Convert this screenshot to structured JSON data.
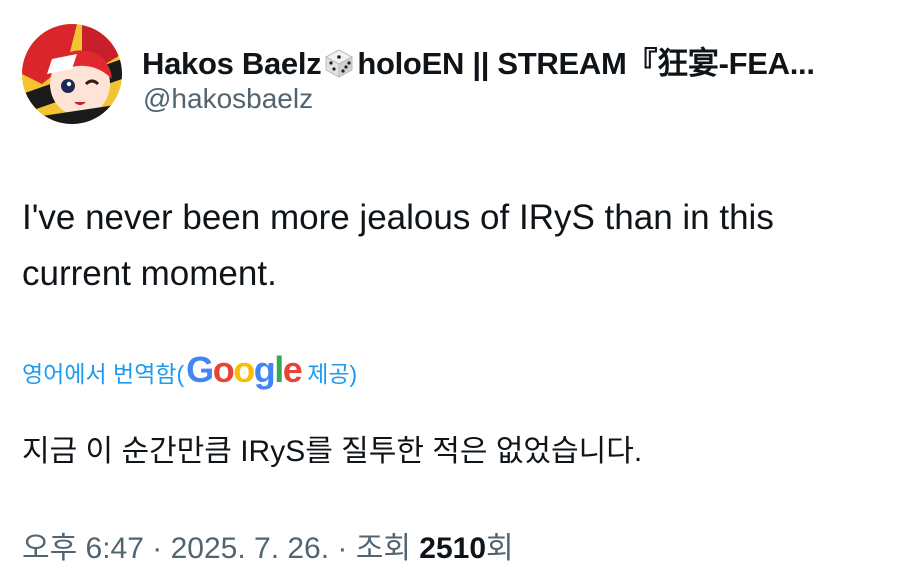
{
  "author": {
    "display_name_pre": "Hakos Baelz",
    "display_name_post": "holoEN || STREAM『狂宴-FEA...",
    "name_icon": "dice-icon",
    "handle": "@hakosbaelz",
    "avatar_icon": "avatar-icon"
  },
  "tweet": {
    "text": "I've never been more jealous of IRyS than in this current moment."
  },
  "translation": {
    "label_pre": "영어에서 번역함(",
    "provider_logo": "Google",
    "label_post": " 제공)",
    "text": "지금 이 순간만큼 IRyS를 질투한 적은 없었습니다."
  },
  "meta": {
    "time": "오후 6:47",
    "separator1": " · ",
    "date": "2025. 7. 26.",
    "separator2": " · ",
    "views_label": "조회 ",
    "views_count": "2510",
    "views_suffix": "회"
  },
  "colors": {
    "link": "#1d9bf0",
    "secondary_text": "#536471",
    "primary_text": "#0f1419"
  }
}
